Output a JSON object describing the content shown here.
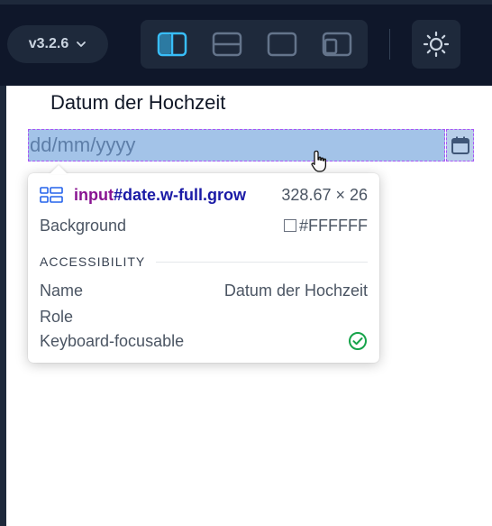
{
  "toolbar": {
    "version_label": "v3.2.6",
    "layout_buttons": [
      "split-vertical",
      "split-horizontal",
      "single",
      "overlay"
    ],
    "active_layout": "split-vertical",
    "accent_color": "#38bdf8"
  },
  "preview": {
    "field_label": "Datum der Hochzeit",
    "date_input": {
      "placeholder": "dd/mm/yyyy",
      "value": ""
    }
  },
  "inspector": {
    "selector_tag": "input",
    "selector_rest": "#date.w-full.grow",
    "dimensions": "328.67 × 26",
    "background_label": "Background",
    "background_value": "#FFFFFF",
    "section_title": "ACCESSIBILITY",
    "name_label": "Name",
    "name_value": "Datum der Hochzeit",
    "role_label": "Role",
    "role_value": "",
    "keyboard_label": "Keyboard-focusable",
    "keyboard_focusable": true
  }
}
